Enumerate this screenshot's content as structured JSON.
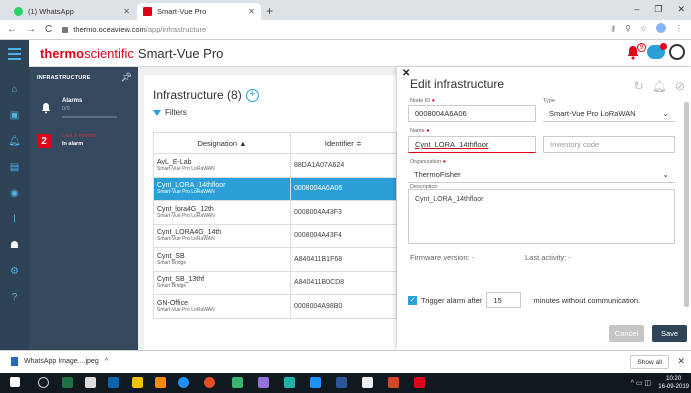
{
  "browser": {
    "tabs": [
      {
        "label": "(1) WhatsApp",
        "color": "#25d366"
      },
      {
        "label": "Smart-Vue Pro",
        "color": "#e1001a"
      }
    ],
    "url_host": "thermo.oceaview.com",
    "url_path": "/app/infrastructure"
  },
  "header": {
    "brand_bold": "thermo",
    "brand_sci": "scientific",
    "product": "Smart-Vue Pro",
    "bell_badge": "9"
  },
  "infra_panel": {
    "title": "INFRASTRUCTURE",
    "alarms_label": "Alarms",
    "alarms_value": "0/9",
    "alarm_count": "2",
    "last_label": "Last 3 months",
    "in_alarm_label": "In alarm"
  },
  "list": {
    "title": "Infrastructure (8)",
    "filters_label": "Filters",
    "col_designation": "Designation ▲",
    "col_identifier": "Identifier ≑",
    "rows": [
      {
        "name": "AvL_E-Lab",
        "type": "Smart-Vue Pro LoRaWAN",
        "id": "88DA1A07A624"
      },
      {
        "name": "Cynt_LORA_14thfloor",
        "type": "Smart-Vue Pro LoRaWAN",
        "id": "0008004A6A06"
      },
      {
        "name": "Cynt_lora4G_12th",
        "type": "Smart-Vue Pro LoRaWAN",
        "id": "0008004A43F3"
      },
      {
        "name": "Cynt_LORA4G_14th",
        "type": "Smart-Vue Pro LoRaWAN",
        "id": "0008004A43F4"
      },
      {
        "name": "Cynt_SB",
        "type": "Smart Bridge",
        "id": "A840411B1F68"
      },
      {
        "name": "Cynt_SB_13thf",
        "type": "Smart Bridge",
        "id": "A840411B0CD8"
      },
      {
        "name": "GN-Office",
        "type": "Smart-Vue Pro LoRaWAN",
        "id": "0008004A98B0"
      }
    ]
  },
  "edit": {
    "title": "Edit infrastructure",
    "node_id_label": "Node ID",
    "node_id_value": "0008004A6A06",
    "type_label": "Type",
    "type_value": "Smart-Vue Pro LoRaWAN",
    "name_label": "Name",
    "name_value": "Cynt_LORA_14thfloor",
    "inventory_placeholder": "Inventory code",
    "org_label": "Organization",
    "org_value": "ThermoFisher",
    "desc_label": "Description",
    "desc_value": "Cynt_LORA_14thfloor",
    "firmware_label": "Firmware version: -",
    "activity_label": "Last activity: -",
    "trigger_label": "Trigger alarm after",
    "trigger_value": "15",
    "trigger_suffix": "minutes without communication.",
    "cancel_label": "Cancel",
    "save_label": "Save"
  },
  "download": {
    "file": "WhatsApp Image....jpeg",
    "show_all": "Show all"
  },
  "taskbar": {
    "time": "10:20",
    "date": "16-09-2019"
  }
}
